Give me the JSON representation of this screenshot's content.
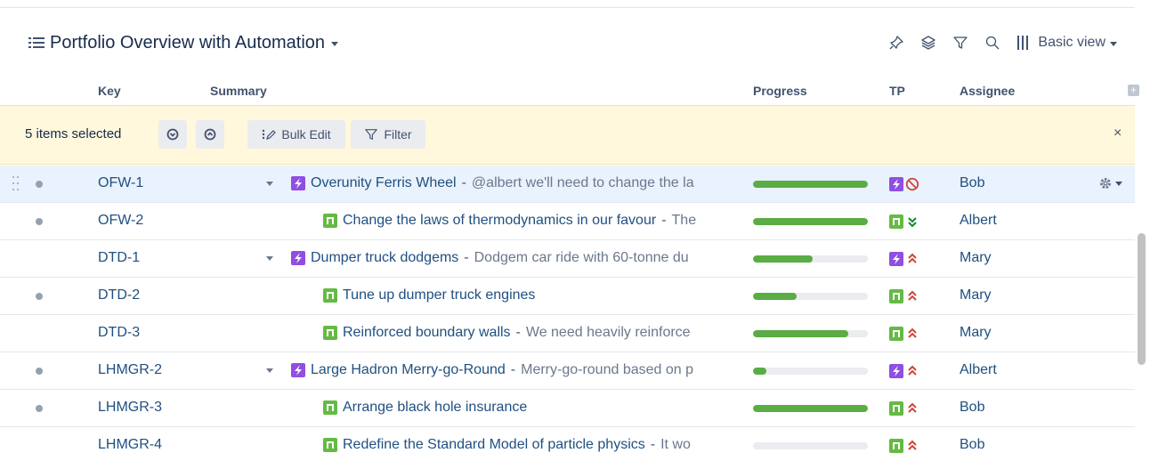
{
  "header": {
    "title": "Portfolio Overview with Automation",
    "view_label": "Basic view"
  },
  "columns": {
    "key": "Key",
    "summary": "Summary",
    "progress": "Progress",
    "tp": "TP",
    "assignee": "Assignee"
  },
  "selection_bar": {
    "count_text": "5 items selected",
    "bulk_edit": "Bulk Edit",
    "filter": "Filter",
    "close": "×"
  },
  "rows": [
    {
      "key": "OFW-1",
      "type": "epic",
      "title": "Overunity Ferris Wheel",
      "desc": "@albert we'll need to change the la",
      "progress": 1.0,
      "priority": "blocker",
      "assignee": "Bob",
      "selected": true
    },
    {
      "key": "OFW-2",
      "type": "story",
      "title": "Change the laws of thermodynamics in our favour",
      "desc": "The",
      "progress": 1.0,
      "priority": "lowest",
      "assignee": "Albert",
      "selected": false
    },
    {
      "key": "DTD-1",
      "type": "epic",
      "title": "Dumper truck dodgems",
      "desc": "Dodgem car ride with 60-tonne du",
      "progress": 0.52,
      "priority": "highest",
      "assignee": "Mary",
      "selected": false
    },
    {
      "key": "DTD-2",
      "type": "story",
      "title": "Tune up dumper truck engines",
      "desc": "",
      "progress": 0.38,
      "priority": "highest",
      "assignee": "Mary",
      "selected": false
    },
    {
      "key": "DTD-3",
      "type": "story",
      "title": "Reinforced boundary walls",
      "desc": "We need heavily reinforce",
      "progress": 0.83,
      "priority": "highest",
      "assignee": "Mary",
      "selected": false
    },
    {
      "key": "LHMGR-2",
      "type": "epic",
      "title": "Large Hadron Merry-go-Round",
      "desc": "Merry-go-round based on p",
      "progress": 0.12,
      "priority": "highest",
      "assignee": "Albert",
      "selected": false
    },
    {
      "key": "LHMGR-3",
      "type": "story",
      "title": "Arrange black hole insurance",
      "desc": "",
      "progress": 1.0,
      "priority": "highest",
      "assignee": "Bob",
      "selected": false
    },
    {
      "key": "LHMGR-4",
      "type": "story",
      "title": "Redefine the Standard Model of particle physics",
      "desc": "It wo",
      "progress": 0.0,
      "priority": "highest",
      "assignee": "Bob",
      "selected": false
    }
  ],
  "colors": {
    "link": "#205081",
    "epic": "#904ee2",
    "story": "#65ba43",
    "progress_fill": "#5aac44",
    "priority_high": "#d04437",
    "priority_low": "#14892c",
    "selection_bg": "#fff8dc",
    "row_selected_bg": "#e9f2fd"
  },
  "icons": {
    "title": "list-icon",
    "pin": "pin-icon",
    "layers": "layers-icon",
    "filter": "filter-icon",
    "search": "search-icon",
    "view": "columns-icon",
    "settings": "gear-icon"
  }
}
